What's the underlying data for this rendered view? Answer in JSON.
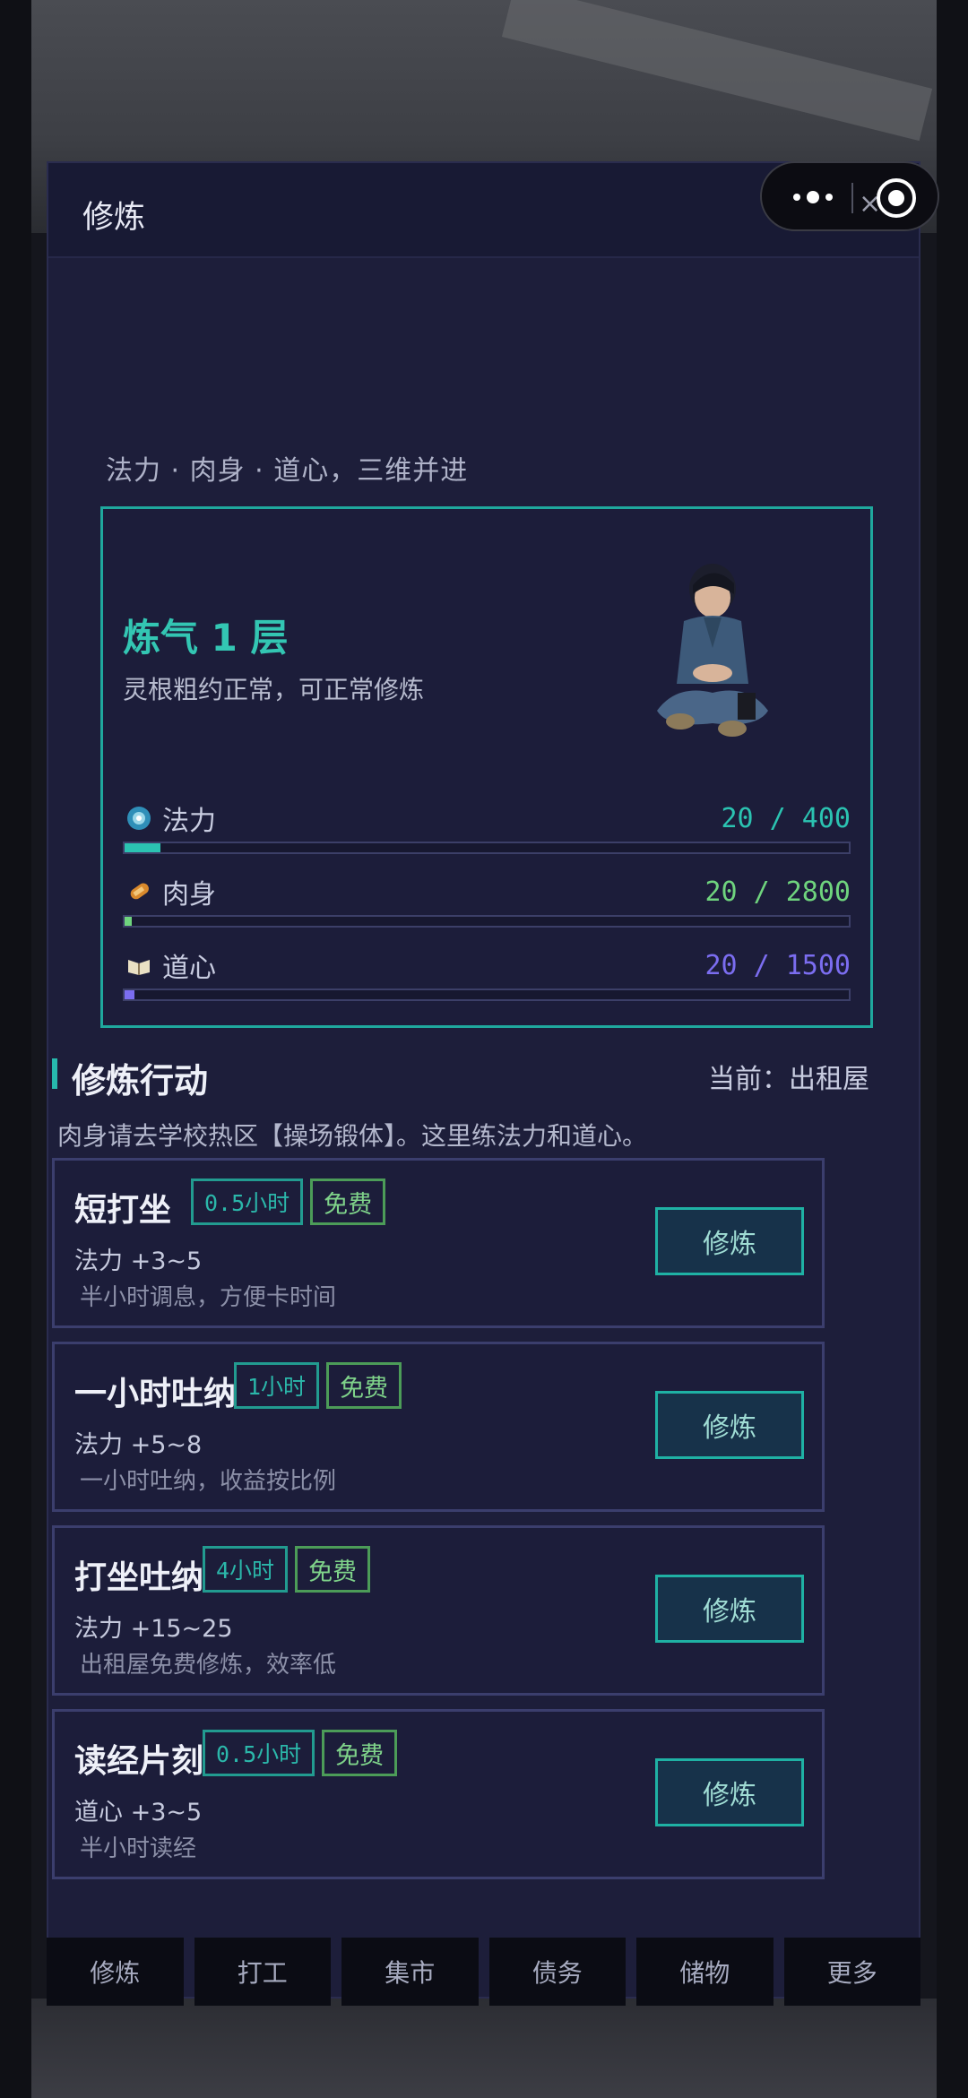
{
  "header": {
    "title": "修炼"
  },
  "subtitle": "法力 · 肉身 · 道心，三维并进",
  "status": {
    "realm": "炼气 1 层",
    "description": "灵根粗约正常，可正常修炼",
    "stats": [
      {
        "label": "法力",
        "value": "20 / 400",
        "progress": 0.05,
        "color": "#2bc3b1",
        "icon": "mana-orb-icon"
      },
      {
        "label": "肉身",
        "value": "20 / 2800",
        "progress": 0.007,
        "color": "#6fd47e",
        "icon": "body-icon"
      },
      {
        "label": "道心",
        "value": "20 / 1500",
        "progress": 0.013,
        "color": "#7b6df0",
        "icon": "scroll-book-icon"
      }
    ]
  },
  "section": {
    "title": "修炼行动",
    "current": "当前：出租屋",
    "note": "肉身请去学校热区【操场锻体】。这里练法力和道心。"
  },
  "actions": [
    {
      "name": "短打坐",
      "time": "0.5小时",
      "cost": "免费",
      "effect": "法力 +3~5",
      "desc": "半小时调息，方便卡时间",
      "button": "修炼"
    },
    {
      "name": "一小时吐纳",
      "time": "1小时",
      "cost": "免费",
      "effect": "法力 +5~8",
      "desc": "一小时吐纳，收益按比例",
      "button": "修炼"
    },
    {
      "name": "打坐吐纳",
      "time": "4小时",
      "cost": "免费",
      "effect": "法力 +15~25",
      "desc": "出租屋免费修炼，效率低",
      "button": "修炼"
    },
    {
      "name": "读经片刻",
      "time": "0.5小时",
      "cost": "免费",
      "effect": "道心 +3~5",
      "desc": "半小时读经",
      "button": "修炼"
    }
  ],
  "nav": [
    "修炼",
    "打工",
    "集市",
    "债务",
    "储物",
    "更多"
  ]
}
